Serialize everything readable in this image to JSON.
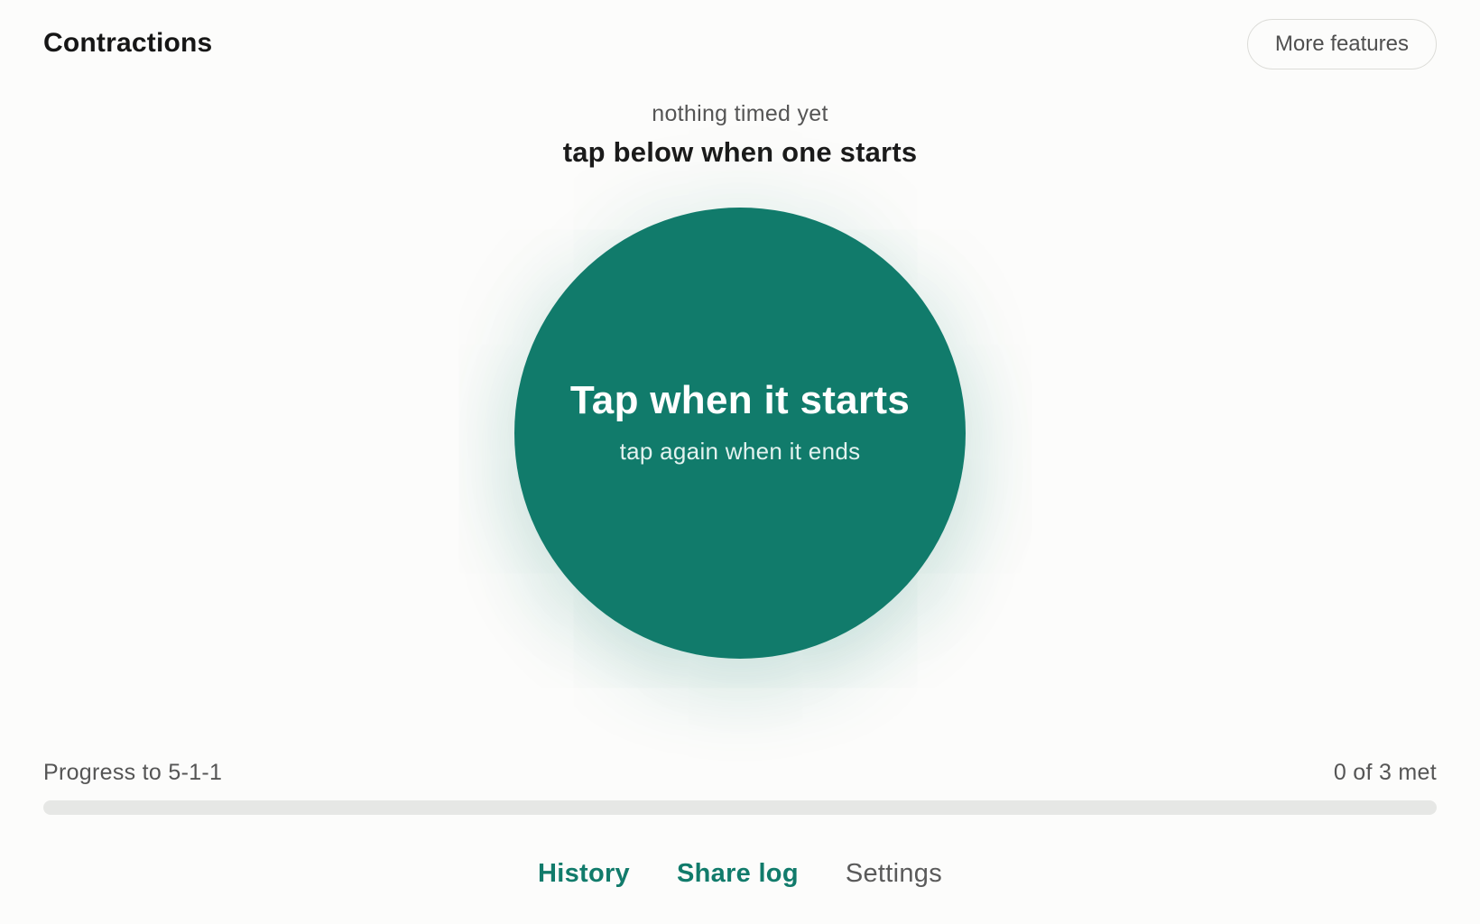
{
  "header": {
    "title": "Contractions",
    "more_button_label": "More features"
  },
  "status": {
    "line": "nothing timed yet",
    "hint": "tap below when one starts"
  },
  "timer_button": {
    "title": "Tap when it starts",
    "subtitle": "tap again when it ends"
  },
  "progress": {
    "label": "Progress to 5-1-1",
    "count_text": "0 of 3 met",
    "met": 0,
    "total": 3
  },
  "nav": {
    "history": "History",
    "share_log": "Share log",
    "settings": "Settings"
  },
  "colors": {
    "accent": "#117b6b",
    "track": "#e6e7e5",
    "background": "#fcfcfb"
  }
}
